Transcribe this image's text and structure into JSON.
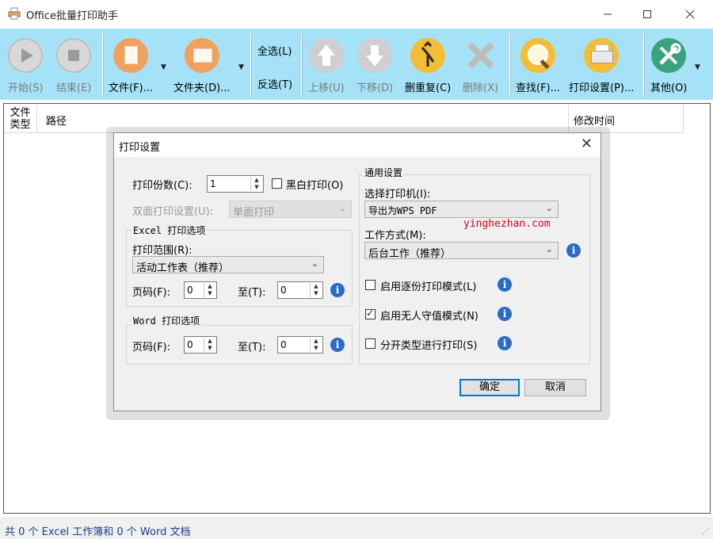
{
  "window": {
    "title": "Office批量打印助手"
  },
  "toolbar": {
    "start": "开始(S)",
    "stop": "结束(E)",
    "file": "文件(F)...",
    "folder": "文件夹(D)...",
    "select_all": "全选(L)",
    "invert": "反选(T)",
    "move_up": "上移(U)",
    "move_down": "下移(D)",
    "dedupe": "删重复(C)",
    "delete": "删除(X)",
    "find": "查找(F)...",
    "print_settings": "打印设置(P)...",
    "other": "其他(O)"
  },
  "list": {
    "columns": [
      "文件类型",
      "路径",
      "修改时间"
    ],
    "col_type_line1": "文件",
    "col_type_line2": "类型",
    "rows": []
  },
  "status": {
    "text": "共 0 个 Excel 工作簿和 0 个 Word 文档"
  },
  "dialog": {
    "title": "打印设置",
    "copies_label": "打印份数(C):",
    "copies_value": "1",
    "bw_label": "黑白打印(O)",
    "bw_checked": false,
    "duplex_label": "双面打印设置(U):",
    "duplex_value": "单面打印",
    "excel_group": "Excel 打印选项",
    "range_label": "打印范围(R):",
    "range_value": "活动工作表（推荐）",
    "excel_page_label": "页码(F):",
    "excel_page_from": "0",
    "excel_to_label": "至(T):",
    "excel_page_to": "0",
    "word_group": "Word 打印选项",
    "word_page_label": "页码(F):",
    "word_page_from": "0",
    "word_to_label": "至(T):",
    "word_page_to": "0",
    "general_group": "通用设置",
    "printer_label": "选择打印机(I):",
    "printer_value": "导出为WPS PDF",
    "mode_label": "工作方式(M):",
    "mode_value": "后台工作（推荐）",
    "copy_mode_label": "启用逐份打印模式(L)",
    "copy_mode_checked": false,
    "unattended_label": "启用无人守值模式(N)",
    "unattended_checked": true,
    "split_label": "分开类型进行打印(S)",
    "split_checked": false,
    "ok": "确定",
    "cancel": "取消"
  },
  "watermark": "yinghezhan.com",
  "colors": {
    "toolbar_bg": "#a6e2f7",
    "status_text": "#1a3e8e",
    "info_blue": "#2b6cc4",
    "default_button_border": "#0078d7"
  }
}
